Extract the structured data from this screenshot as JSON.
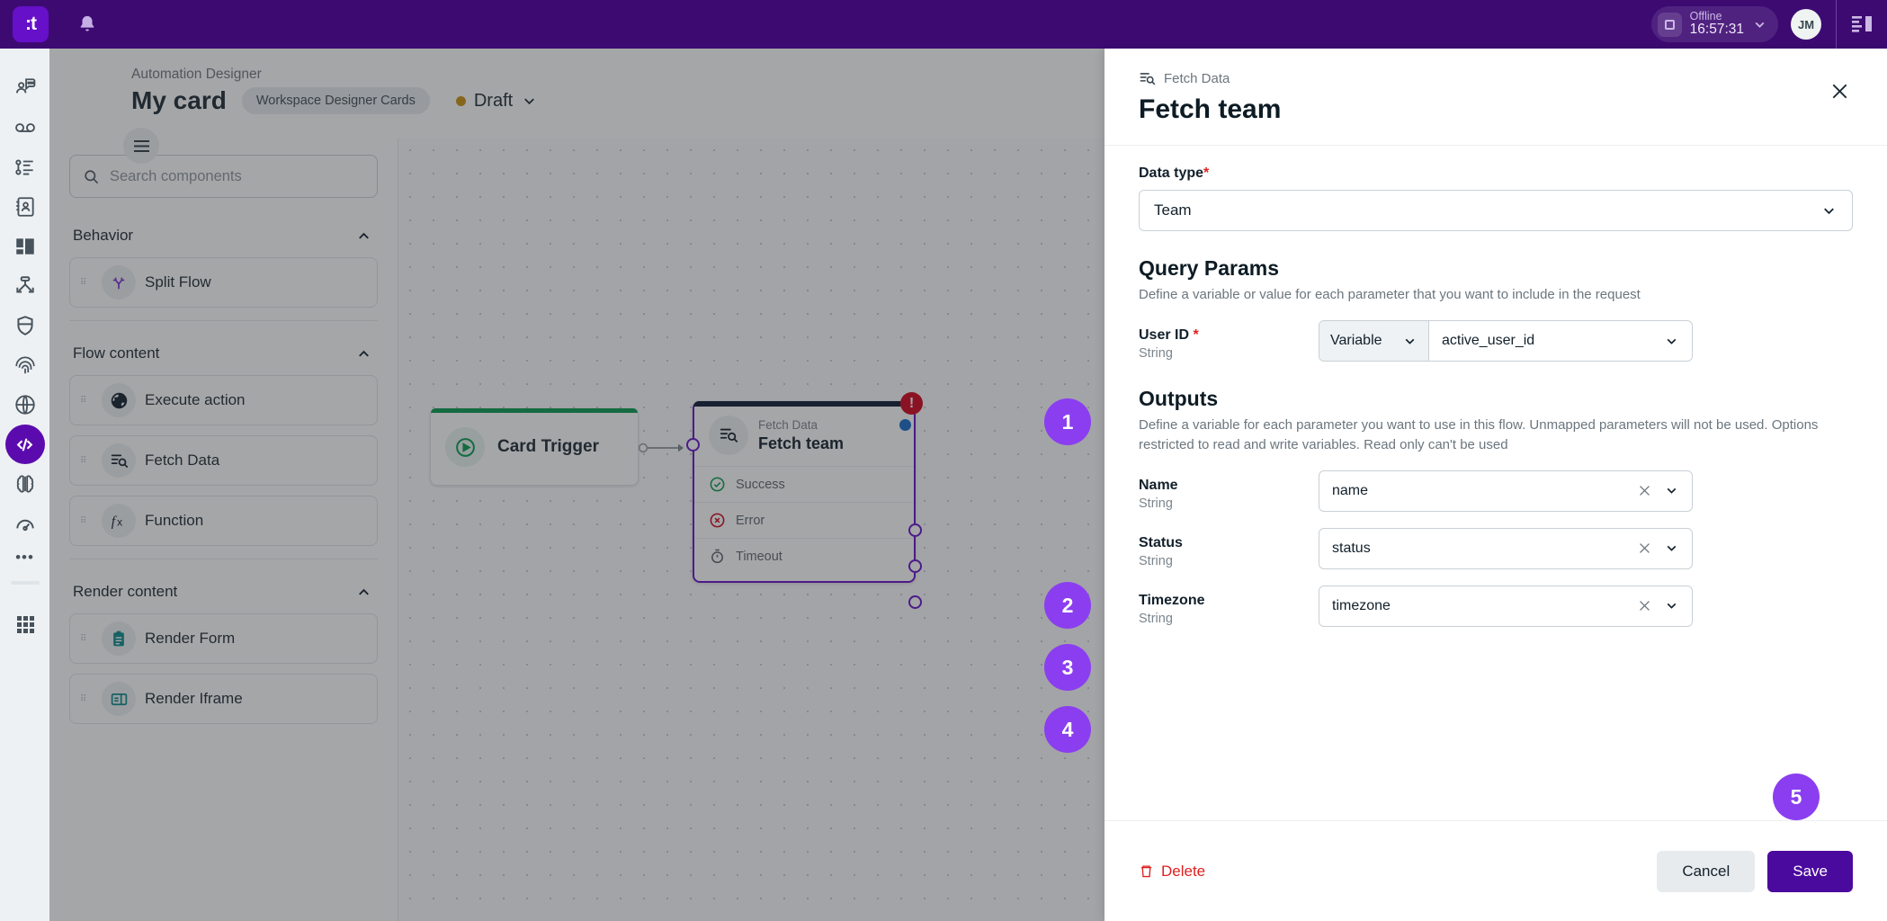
{
  "topbar": {
    "logo_text": ":t",
    "bell_icon": "bell-icon",
    "status": {
      "label": "Offline",
      "time": "16:57:31"
    },
    "avatar_initials": "JM"
  },
  "rail": {
    "items": [
      {
        "name": "sidebar-item-support-chat",
        "icon": "person-chat-icon"
      },
      {
        "name": "sidebar-item-voicemail",
        "icon": "voicemail-icon"
      },
      {
        "name": "sidebar-item-queue-list",
        "icon": "queue-list-icon"
      },
      {
        "name": "sidebar-item-contacts",
        "icon": "contact-book-icon"
      },
      {
        "name": "sidebar-item-layouts",
        "icon": "layout-panels-icon"
      },
      {
        "name": "sidebar-item-routing",
        "icon": "routing-arrows-icon"
      },
      {
        "name": "sidebar-item-security",
        "icon": "shield-icon"
      },
      {
        "name": "sidebar-item-biometrics",
        "icon": "fingerprint-icon"
      },
      {
        "name": "sidebar-item-web",
        "icon": "globe-icon"
      },
      {
        "name": "sidebar-item-developer",
        "icon": "code-brackets-icon"
      },
      {
        "name": "sidebar-item-ai",
        "icon": "brain-icon"
      },
      {
        "name": "sidebar-item-performance",
        "icon": "gauge-icon"
      },
      {
        "name": "sidebar-item-more",
        "icon": "ellipsis-icon"
      },
      {
        "name": "sidebar-item-apps",
        "icon": "grid-apps-icon"
      }
    ]
  },
  "designer": {
    "breadcrumb": "Automation Designer",
    "title": "My card",
    "chip": "Workspace Designer Cards",
    "status": "Draft",
    "status_color": "#c8920f",
    "search": {
      "placeholder": "Search components"
    },
    "groups": [
      {
        "title": "Behavior",
        "items": [
          {
            "label": "Split Flow",
            "icon": "split-flow-icon",
            "color": "#7a2fd6"
          }
        ]
      },
      {
        "title": "Flow content",
        "items": [
          {
            "label": "Execute action",
            "icon": "globe-action-icon",
            "color": "#12202b"
          },
          {
            "label": "Fetch Data",
            "icon": "fetch-data-icon",
            "color": "#12202b"
          },
          {
            "label": "Function",
            "icon": "function-fx-icon",
            "color": "#12202b"
          }
        ]
      },
      {
        "title": "Render content",
        "items": [
          {
            "label": "Render Form",
            "icon": "clipboard-form-icon",
            "color": "#0c8b8b"
          },
          {
            "label": "Render Iframe",
            "icon": "iframe-icon",
            "color": "#0c8b8b"
          }
        ]
      }
    ],
    "canvas": {
      "trigger_node": {
        "label": "Card Trigger",
        "icon": "play-circle-icon",
        "accent": "#069a4e"
      },
      "fetch_node": {
        "kicker": "Fetch Data",
        "name": "Fetch team",
        "icon": "fetch-data-icon",
        "error_badge": "!",
        "outputs": [
          {
            "label": "Success",
            "icon": "check-circle-icon",
            "color": "#069a4e"
          },
          {
            "label": "Error",
            "icon": "error-circle-icon",
            "color": "#d0021b"
          },
          {
            "label": "Timeout",
            "icon": "timer-icon",
            "color": "#5d686f"
          }
        ]
      }
    }
  },
  "drawer": {
    "kicker": "Fetch Data",
    "kicker_icon": "fetch-data-icon",
    "title": "Fetch team",
    "close_icon": "close-icon",
    "data_type": {
      "label": "Data type",
      "required": "*",
      "value": "Team"
    },
    "query_params": {
      "title": "Query Params",
      "description": "Define a variable or value for each parameter that you want to include in the request",
      "rows": [
        {
          "label": "User ID",
          "required": "*",
          "type": "String",
          "mode": "Variable",
          "value": "active_user_id"
        }
      ]
    },
    "outputs": {
      "title": "Outputs",
      "description": "Define a variable for each parameter you want to use in this flow. Unmapped parameters will not be used. Options restricted to read and write variables. Read only can't be used",
      "rows": [
        {
          "label": "Name",
          "type": "String",
          "value": "name"
        },
        {
          "label": "Status",
          "type": "String",
          "value": "status"
        },
        {
          "label": "Timezone",
          "type": "String",
          "value": "timezone"
        }
      ]
    },
    "footer": {
      "delete_label": "Delete",
      "cancel_label": "Cancel",
      "save_label": "Save"
    }
  },
  "steps": [
    {
      "n": "1"
    },
    {
      "n": "2"
    },
    {
      "n": "3"
    },
    {
      "n": "4"
    },
    {
      "n": "5"
    }
  ],
  "colors": {
    "brand_purple": "#4b0a9e",
    "topbar": "#3d0a72",
    "step_badge": "#8b3ef0",
    "danger": "#e02020"
  }
}
